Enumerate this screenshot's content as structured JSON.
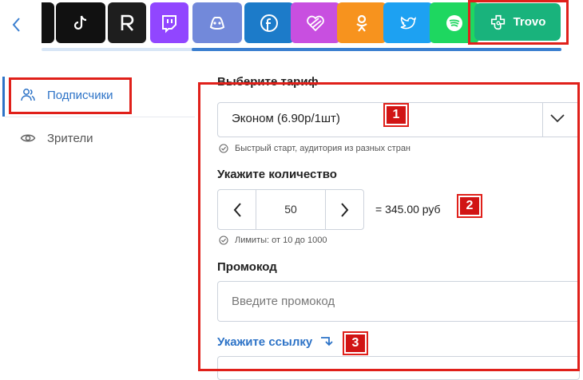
{
  "platforms": [
    {
      "name": "platform-partial-icon",
      "icon": "partial-tile",
      "bg": "#111111"
    },
    {
      "name": "tiktok-button",
      "icon": "tiktok-icon",
      "bg": "#111111"
    },
    {
      "name": "rumble-button",
      "icon": "r-logo-icon",
      "bg": "#1e1e1e"
    },
    {
      "name": "twitch-button",
      "icon": "twitch-icon",
      "bg": "#9146ff"
    },
    {
      "name": "discord-button",
      "icon": "discord-icon",
      "bg": "#7289da"
    },
    {
      "name": "facebook-button",
      "icon": "facebook-icon",
      "bg": "#1c7bc9"
    },
    {
      "name": "likee-button",
      "icon": "heart-stripes-icon",
      "bg": "#c84fe0"
    },
    {
      "name": "odnoklassniki-button",
      "icon": "ok-icon",
      "bg": "#f7931e"
    },
    {
      "name": "twitter-button",
      "icon": "twitter-icon",
      "bg": "#1da1f2"
    },
    {
      "name": "spotify-button",
      "icon": "spotify-icon",
      "bg": "#1ed760"
    }
  ],
  "selected_platform": {
    "label": "Trovo",
    "icon": "trovo-icon",
    "bg": "#19b37c"
  },
  "sidebar": {
    "items": [
      {
        "label": "Подписчики",
        "icon": "users-icon",
        "active": true
      },
      {
        "label": "Зрители",
        "icon": "eye-icon",
        "active": false
      }
    ]
  },
  "form": {
    "tariff_label": "Выберите тариф",
    "tariff_value": "Эконом (6.90р/1шт)",
    "tariff_hint": "Быстрый старт, аудитория из разных стран",
    "quantity_label": "Укажите количество",
    "quantity_value": "50",
    "total": "= 345.00 руб",
    "quantity_hint": "Лимиты: от 10 до 1000",
    "promo_label": "Промокод",
    "promo_placeholder": "Введите промокод",
    "link_label": "Укажите ссылку"
  },
  "annotations": [
    "1",
    "2",
    "3"
  ],
  "colors": {
    "accent": "#2d73c7",
    "highlight": "#e0201a",
    "trovo": "#19b37c"
  }
}
